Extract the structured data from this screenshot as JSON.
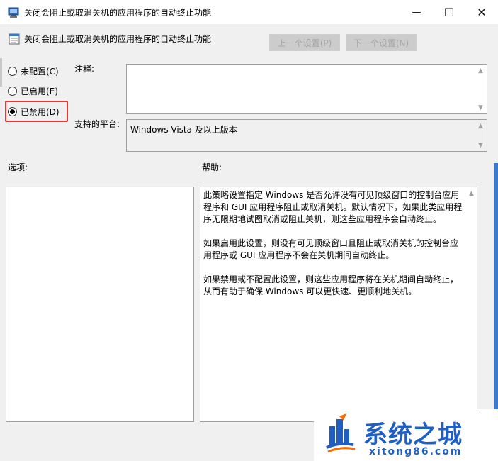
{
  "window": {
    "title": "关闭会阻止或取消关机的应用程序的自动终止功能",
    "min_glyph": "—",
    "max_glyph": "☐",
    "close_glyph": "✕"
  },
  "header": {
    "setting_title": "关闭会阻止或取消关机的应用程序的自动终止功能",
    "prev_button": "上一个设置(P)",
    "next_button": "下一个设置(N)"
  },
  "radios": [
    {
      "label": "未配置(C)",
      "checked": false
    },
    {
      "label": "已启用(E)",
      "checked": false
    },
    {
      "label": "已禁用(D)",
      "checked": true
    }
  ],
  "comment": {
    "label": "注释:",
    "value": ""
  },
  "platform": {
    "label": "支持的平台:",
    "value": "Windows Vista 及以上版本"
  },
  "options": {
    "label": "选项:"
  },
  "help": {
    "label": "帮助:",
    "paragraphs": [
      "此策略设置指定 Windows 是否允许没有可见顶级窗口的控制台应用程序和 GUI 应用程序阻止或取消关机。默认情况下，如果此类应用程序无限期地试图取消或阻止关机，则这些应用程序会自动终止。",
      "如果启用此设置，则没有可见顶级窗口且阻止或取消关机的控制台应用程序或 GUI 应用程序不会在关机期间自动终止。",
      "如果禁用或不配置此设置，则这些应用程序将在关机期间自动终止，从而有助于确保 Windows 可以更快速、更顺利地关机。"
    ]
  },
  "watermark": {
    "name": "系统之城",
    "url": "xitong86.com"
  },
  "colors": {
    "highlight": "#e53935",
    "watermark_blue": "#1f5fc4",
    "watermark_accent": "#ff6a00"
  }
}
